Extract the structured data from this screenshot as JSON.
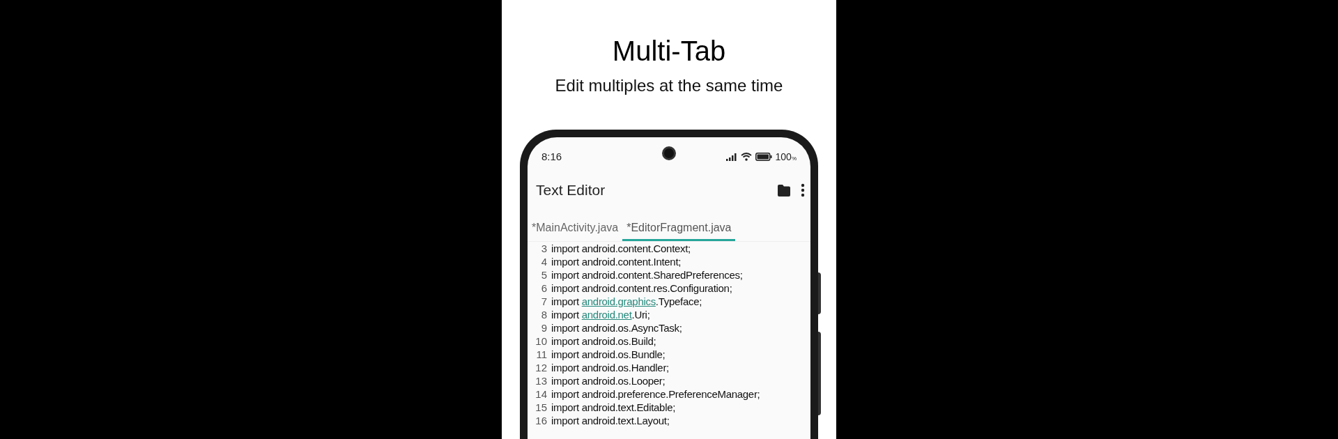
{
  "headline": {
    "title": "Multi-Tab",
    "subtitle": "Edit multiples at the same time"
  },
  "status_bar": {
    "time": "8:16",
    "battery": "100",
    "battery_unit": "%"
  },
  "app_bar": {
    "title": "Text Editor"
  },
  "tabs": [
    {
      "label": "*MainActivity.java",
      "selected": false
    },
    {
      "label": "*EditorFragment.java",
      "selected": true
    }
  ],
  "code_lines": [
    {
      "number": "3",
      "parts": [
        {
          "kind": "plain",
          "text": "import android.content.Context;"
        }
      ]
    },
    {
      "number": "4",
      "parts": [
        {
          "kind": "plain",
          "text": "import android.content.Intent;"
        }
      ]
    },
    {
      "number": "5",
      "parts": [
        {
          "kind": "plain",
          "text": "import android.content.SharedPreferences;"
        }
      ]
    },
    {
      "number": "6",
      "parts": [
        {
          "kind": "plain",
          "text": "import android.content.res.Configuration;"
        }
      ]
    },
    {
      "number": "7",
      "parts": [
        {
          "kind": "plain",
          "text": "import "
        },
        {
          "kind": "link",
          "text": "android.graphics"
        },
        {
          "kind": "plain",
          "text": ".Typeface;"
        }
      ]
    },
    {
      "number": "8",
      "parts": [
        {
          "kind": "plain",
          "text": "import "
        },
        {
          "kind": "link",
          "text": "android.net"
        },
        {
          "kind": "plain",
          "text": ".Uri;"
        }
      ]
    },
    {
      "number": "9",
      "parts": [
        {
          "kind": "plain",
          "text": "import android.os.AsyncTask;"
        }
      ]
    },
    {
      "number": "10",
      "parts": [
        {
          "kind": "plain",
          "text": "import android.os.Build;"
        }
      ]
    },
    {
      "number": "11",
      "parts": [
        {
          "kind": "plain",
          "text": "import android.os.Bundle;"
        }
      ]
    },
    {
      "number": "12",
      "parts": [
        {
          "kind": "plain",
          "text": "import android.os.Handler;"
        }
      ]
    },
    {
      "number": "13",
      "parts": [
        {
          "kind": "plain",
          "text": "import android.os.Looper;"
        }
      ]
    },
    {
      "number": "14",
      "parts": [
        {
          "kind": "plain",
          "text": "import android.preference.PreferenceManager;"
        }
      ]
    },
    {
      "number": "15",
      "parts": [
        {
          "kind": "plain",
          "text": "import android.text.Editable;"
        }
      ]
    },
    {
      "number": "16",
      "parts": [
        {
          "kind": "plain",
          "text": "import android.text.Layout;"
        }
      ]
    }
  ]
}
